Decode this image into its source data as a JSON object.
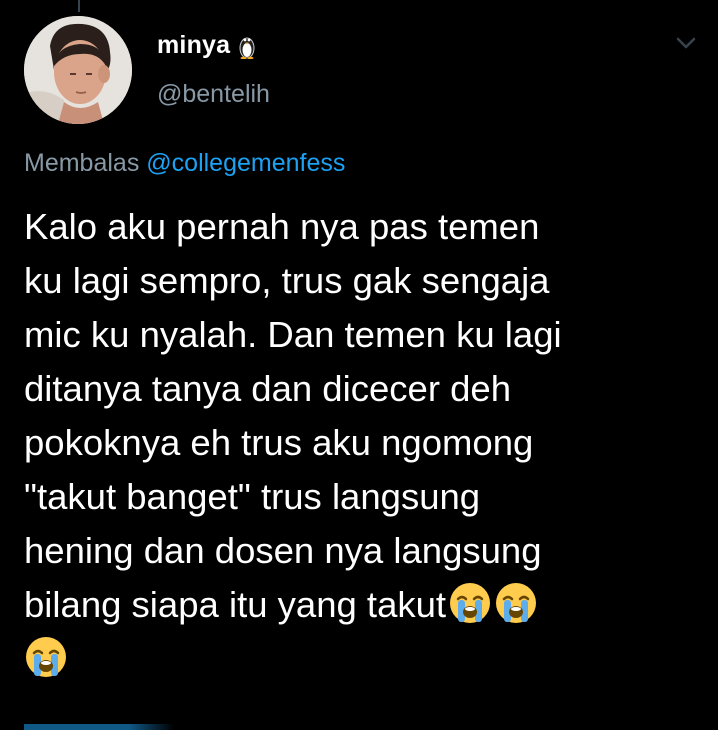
{
  "author": {
    "display_name": "minya",
    "handle": "@bentelih",
    "badge_icon": "penguin-icon"
  },
  "reply": {
    "prefix": "Membalas",
    "mention": "@collegemenfess"
  },
  "tweet": {
    "text_lines": [
      "Kalo aku pernah nya pas temen",
      "ku lagi sempro, trus gak sengaja",
      "mic ku nyalah. Dan temen ku lagi",
      "ditanya tanya dan dicecer deh",
      "pokoknya eh trus aku ngomong",
      "\"takut banget\" trus langsung",
      "hening dan dosen nya langsung",
      "bilang siapa itu yang takut"
    ],
    "emojis": [
      "loudly-crying-face-icon",
      "loudly-crying-face-icon",
      "loudly-crying-face-icon"
    ]
  },
  "colors": {
    "background": "#000000",
    "text": "#ffffff",
    "secondary": "#8899a6",
    "link": "#1da1f2"
  }
}
